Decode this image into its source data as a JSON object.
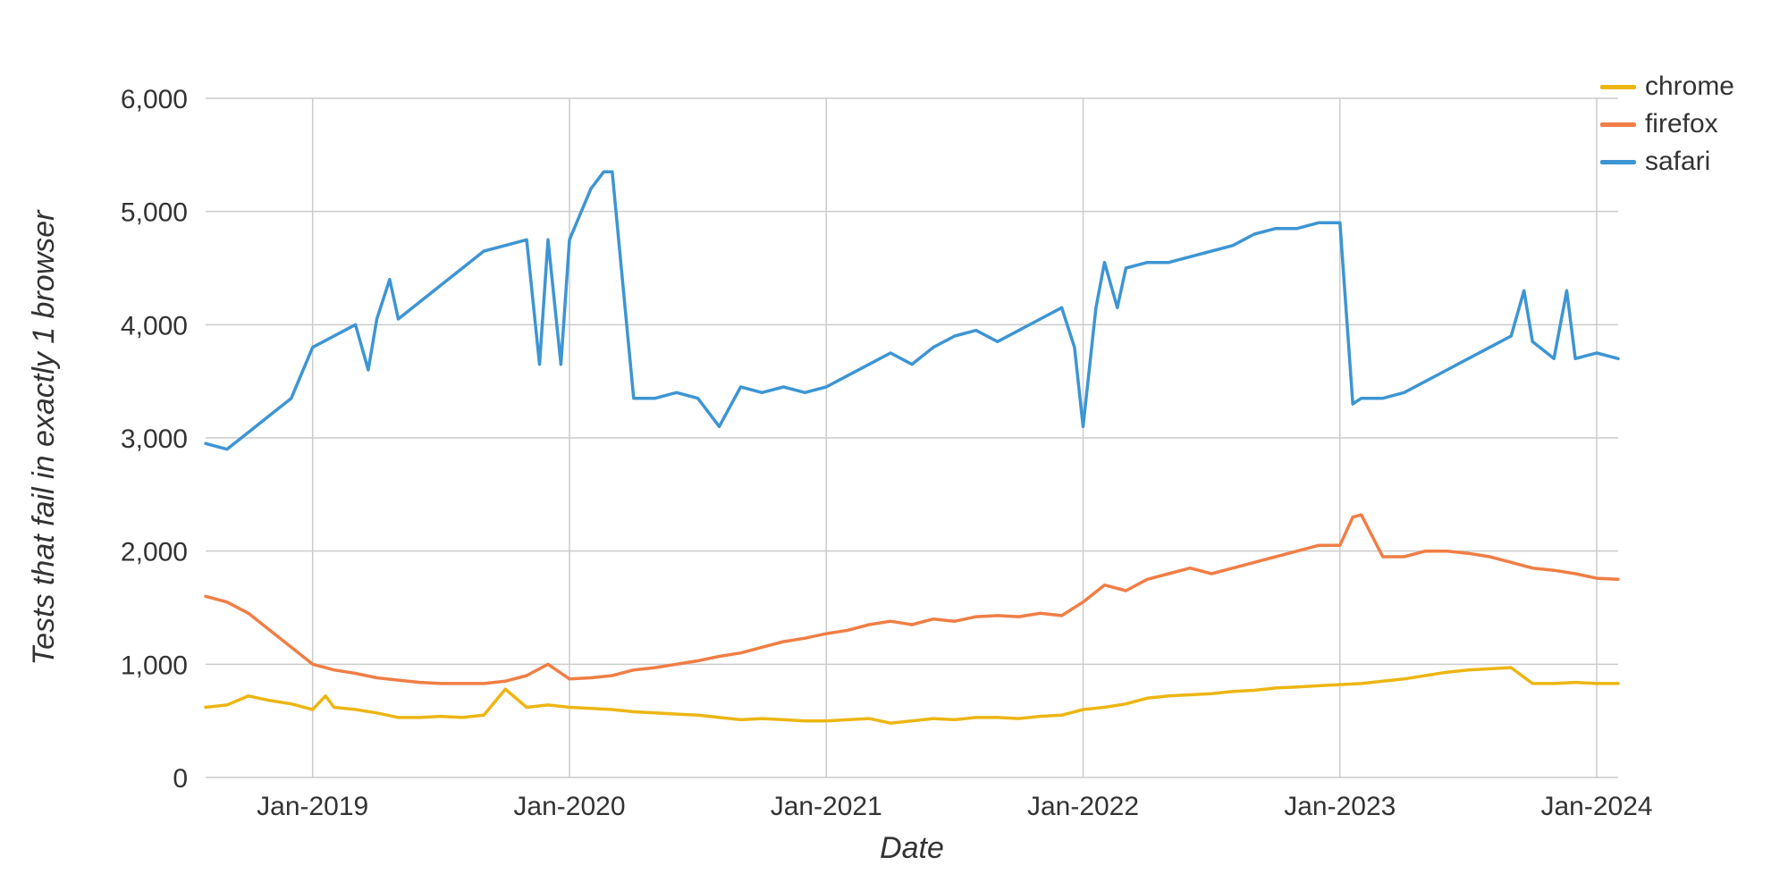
{
  "chart_data": {
    "type": "line",
    "title": "",
    "xlabel": "Date",
    "ylabel": "Tests that fail in exactly 1 browser",
    "ylim": [
      0,
      6000
    ],
    "x_ticks": [
      "Jan-2019",
      "Jan-2020",
      "Jan-2021",
      "Jan-2022",
      "Jan-2023",
      "Jan-2024"
    ],
    "y_ticks": [
      0,
      1000,
      2000,
      3000,
      4000,
      5000,
      6000
    ],
    "y_tick_labels": [
      "0",
      "1,000",
      "2,000",
      "3,000",
      "4,000",
      "5,000",
      "6,000"
    ],
    "x_range_months": [
      "2018-08",
      "2024-02"
    ],
    "legend_position": "right",
    "grid": true,
    "series": [
      {
        "name": "chrome",
        "color": "#ecb613",
        "x": [
          "2018-08",
          "2018-09",
          "2018-10",
          "2018-11",
          "2018-12",
          "2019-01",
          "2019-01b",
          "2019-02",
          "2019-03",
          "2019-04",
          "2019-05",
          "2019-06",
          "2019-07",
          "2019-08",
          "2019-09",
          "2019-10",
          "2019-11",
          "2019-12",
          "2020-01",
          "2020-02",
          "2020-03",
          "2020-04",
          "2020-05",
          "2020-06",
          "2020-07",
          "2020-08",
          "2020-09",
          "2020-10",
          "2020-11",
          "2020-12",
          "2021-01",
          "2021-02",
          "2021-03",
          "2021-04",
          "2021-05",
          "2021-06",
          "2021-07",
          "2021-08",
          "2021-09",
          "2021-10",
          "2021-11",
          "2021-12",
          "2022-01",
          "2022-02",
          "2022-03",
          "2022-04",
          "2022-05",
          "2022-06",
          "2022-07",
          "2022-08",
          "2022-09",
          "2022-10",
          "2022-11",
          "2022-12",
          "2023-01",
          "2023-02",
          "2023-03",
          "2023-04",
          "2023-05",
          "2023-06",
          "2023-07",
          "2023-08",
          "2023-09",
          "2023-10",
          "2023-11",
          "2023-12",
          "2024-01",
          "2024-02"
        ],
        "values": [
          620,
          640,
          720,
          680,
          650,
          600,
          720,
          620,
          600,
          570,
          530,
          530,
          540,
          530,
          550,
          780,
          620,
          640,
          620,
          610,
          600,
          580,
          570,
          560,
          550,
          530,
          510,
          520,
          510,
          500,
          500,
          510,
          520,
          480,
          500,
          520,
          510,
          530,
          530,
          520,
          540,
          550,
          600,
          620,
          650,
          700,
          720,
          730,
          740,
          760,
          770,
          790,
          800,
          810,
          820,
          830,
          850,
          870,
          900,
          930,
          950,
          960,
          970,
          830,
          830,
          840,
          830,
          830
        ]
      },
      {
        "name": "firefox",
        "color": "#f07e45",
        "x": [
          "2018-08",
          "2018-09",
          "2018-10",
          "2018-11",
          "2018-12",
          "2019-01",
          "2019-02",
          "2019-03",
          "2019-04",
          "2019-05",
          "2019-06",
          "2019-07",
          "2019-08",
          "2019-09",
          "2019-10",
          "2019-11",
          "2019-12",
          "2020-01",
          "2020-02",
          "2020-03",
          "2020-04",
          "2020-05",
          "2020-06",
          "2020-07",
          "2020-08",
          "2020-09",
          "2020-10",
          "2020-11",
          "2020-12",
          "2021-01",
          "2021-02",
          "2021-03",
          "2021-04",
          "2021-05",
          "2021-06",
          "2021-07",
          "2021-08",
          "2021-09",
          "2021-10",
          "2021-11",
          "2021-12",
          "2022-01",
          "2022-02",
          "2022-03",
          "2022-04",
          "2022-05",
          "2022-06",
          "2022-07",
          "2022-08",
          "2022-09",
          "2022-10",
          "2022-11",
          "2022-12",
          "2023-01",
          "2023-01b",
          "2023-02",
          "2023-03",
          "2023-04",
          "2023-05",
          "2023-06",
          "2023-07",
          "2023-08",
          "2023-09",
          "2023-10",
          "2023-11",
          "2023-12",
          "2024-01",
          "2024-02"
        ],
        "values": [
          1600,
          1550,
          1450,
          1300,
          1150,
          1000,
          950,
          920,
          880,
          860,
          840,
          830,
          830,
          830,
          850,
          900,
          1000,
          870,
          880,
          900,
          950,
          970,
          1000,
          1030,
          1070,
          1100,
          1150,
          1200,
          1230,
          1270,
          1300,
          1350,
          1380,
          1350,
          1400,
          1380,
          1420,
          1430,
          1420,
          1450,
          1430,
          1550,
          1700,
          1650,
          1750,
          1800,
          1850,
          1800,
          1850,
          1900,
          1950,
          2000,
          2050,
          2050,
          2300,
          2320,
          1950,
          1950,
          2000,
          2000,
          1980,
          1950,
          1900,
          1850,
          1830,
          1800,
          1760,
          1750
        ]
      },
      {
        "name": "safari",
        "color": "#3d95d3",
        "x": [
          "2018-08",
          "2018-09",
          "2018-10",
          "2018-11",
          "2018-12",
          "2019-01",
          "2019-02",
          "2019-03",
          "2019-03b",
          "2019-04",
          "2019-04b",
          "2019-05",
          "2019-06",
          "2019-07",
          "2019-08",
          "2019-09",
          "2019-10",
          "2019-11",
          "2019-11b",
          "2019-12",
          "2019-12b",
          "2020-01",
          "2020-02",
          "2020-02b",
          "2020-03",
          "2020-04",
          "2020-05",
          "2020-06",
          "2020-07",
          "2020-08",
          "2020-09",
          "2020-10",
          "2020-11",
          "2020-12",
          "2021-01",
          "2021-02",
          "2021-03",
          "2021-04",
          "2021-05",
          "2021-06",
          "2021-07",
          "2021-08",
          "2021-09",
          "2021-10",
          "2021-11",
          "2021-12",
          "2021-12b",
          "2022-01",
          "2022-01b",
          "2022-02",
          "2022-02b",
          "2022-03",
          "2022-04",
          "2022-05",
          "2022-06",
          "2022-07",
          "2022-08",
          "2022-09",
          "2022-10",
          "2022-11",
          "2022-12",
          "2023-01",
          "2023-01b",
          "2023-02",
          "2023-03",
          "2023-04",
          "2023-05",
          "2023-06",
          "2023-07",
          "2023-08",
          "2023-09",
          "2023-09b",
          "2023-10",
          "2023-11",
          "2023-11b",
          "2023-12",
          "2024-01",
          "2024-02"
        ],
        "values": [
          2950,
          2900,
          3050,
          3200,
          3350,
          3800,
          3900,
          4000,
          3600,
          4050,
          4400,
          4050,
          4200,
          4350,
          4500,
          4650,
          4700,
          4750,
          3650,
          4750,
          3650,
          4750,
          5200,
          5350,
          5350,
          3350,
          3350,
          3400,
          3350,
          3100,
          3450,
          3400,
          3450,
          3400,
          3450,
          3550,
          3650,
          3750,
          3650,
          3800,
          3900,
          3950,
          3850,
          3950,
          4050,
          4150,
          3800,
          3100,
          4150,
          4550,
          4150,
          4500,
          4550,
          4550,
          4600,
          4650,
          4700,
          4800,
          4850,
          4850,
          4900,
          4900,
          3300,
          3350,
          3350,
          3400,
          3500,
          3600,
          3700,
          3800,
          3900,
          4300,
          3850,
          3700,
          4300,
          3700,
          3750,
          3700
        ]
      }
    ]
  }
}
